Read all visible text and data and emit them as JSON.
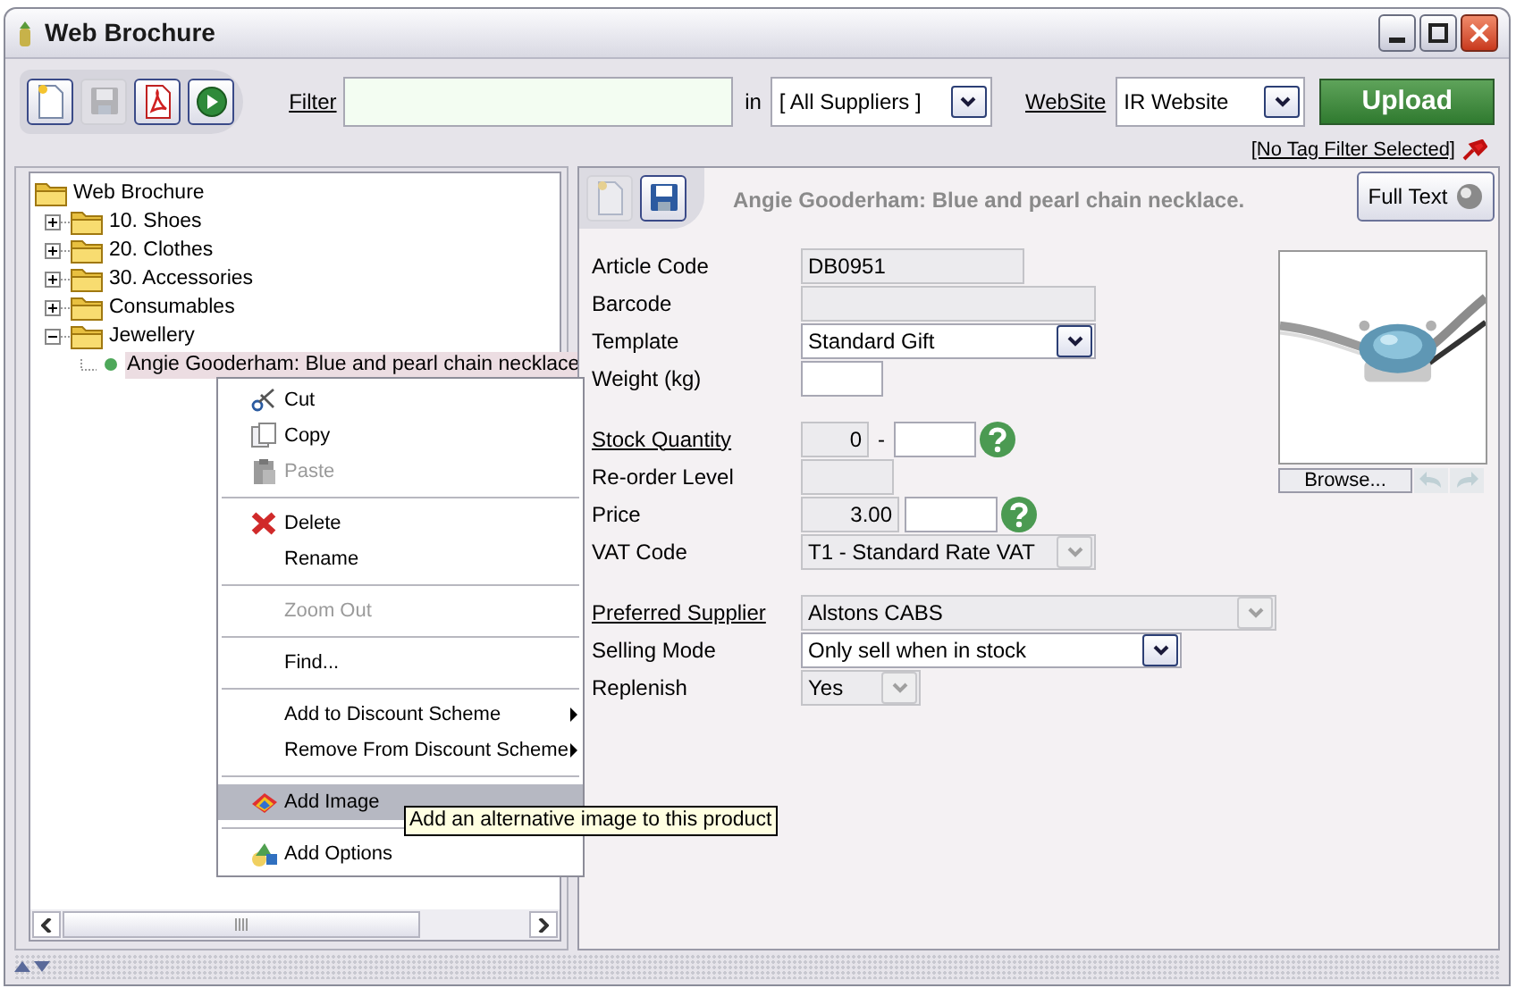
{
  "window": {
    "title": "Web Brochure"
  },
  "toolbar": {
    "buttons": [
      {
        "kind": "new",
        "disabled": false
      },
      {
        "kind": "save",
        "disabled": true
      },
      {
        "kind": "pdf",
        "disabled": false
      },
      {
        "kind": "run",
        "disabled": false
      }
    ],
    "filter": {
      "label": "Filter"
    },
    "in_label": "in",
    "supplier_select": {
      "value": "[ All Suppliers ]"
    },
    "website": {
      "label": "WebSite",
      "value": "IR Website"
    },
    "upload_button": "Upload",
    "tag_filter": "[No Tag Filter Selected]"
  },
  "tree": {
    "label": "Web Brochure",
    "kind": "folder",
    "children": [
      {
        "label": "10. Shoes",
        "kind": "folder",
        "expanded": false
      },
      {
        "label": "20. Clothes",
        "kind": "folder",
        "expanded": false
      },
      {
        "label": "30. Accessories",
        "kind": "folder",
        "expanded": false
      },
      {
        "label": "Consumables",
        "kind": "folder",
        "expanded": false
      },
      {
        "label": "Jewellery",
        "kind": "folder",
        "expanded": true,
        "children": [
          {
            "label": "Angie Gooderham: Blue and pearl chain necklace",
            "kind": "product",
            "selected": true,
            "color": "#4ea85a"
          }
        ]
      }
    ]
  },
  "context_menu": [
    {
      "kind": "item",
      "label": "Cut",
      "disabled": false,
      "selected": false
    },
    {
      "kind": "item",
      "label": "Copy",
      "disabled": false,
      "selected": false
    },
    {
      "kind": "item",
      "label": "Paste",
      "disabled": true,
      "selected": false
    },
    {
      "kind": "separator"
    },
    {
      "kind": "item",
      "label": "Delete",
      "disabled": false,
      "selected": false
    },
    {
      "kind": "item",
      "label": "Rename",
      "disabled": false,
      "selected": false
    },
    {
      "kind": "separator"
    },
    {
      "kind": "item",
      "label": "Zoom Out",
      "disabled": true,
      "selected": false
    },
    {
      "kind": "separator"
    },
    {
      "kind": "item",
      "label": "Find...",
      "disabled": false,
      "selected": false
    },
    {
      "kind": "separator"
    },
    {
      "kind": "item",
      "label": "Add to Discount Scheme",
      "disabled": false,
      "selected": false,
      "submenu": true
    },
    {
      "kind": "item",
      "label": "Remove From Discount Scheme",
      "disabled": false,
      "selected": false,
      "submenu": true
    },
    {
      "kind": "separator"
    },
    {
      "kind": "item",
      "label": "Add Image",
      "disabled": false,
      "selected": true
    },
    {
      "kind": "separator"
    },
    {
      "kind": "item",
      "label": "Add Options",
      "disabled": false,
      "selected": false
    }
  ],
  "tooltip": "Add an alternative image to this product",
  "detail": {
    "buttons": [
      {
        "kind": "new",
        "disabled": true
      },
      {
        "kind": "save",
        "disabled": false
      }
    ],
    "title": "Angie Gooderham: Blue and pearl chain necklace.",
    "full_text_button": "Full Text",
    "groups": [
      [
        {
          "label": "Article Code",
          "link": false,
          "fields": [
            {
              "kind": "input",
              "value": "DB0951",
              "disabled": true
            }
          ]
        },
        {
          "label": "Barcode",
          "link": false,
          "fields": [
            {
              "kind": "input",
              "disabled": true
            }
          ]
        },
        {
          "label": "Template",
          "link": false,
          "fields": [
            {
              "kind": "select",
              "value": "Standard Gift",
              "disabled": false
            }
          ]
        },
        {
          "label": "Weight (kg)",
          "link": false,
          "fields": [
            {
              "kind": "input",
              "disabled": false
            }
          ]
        }
      ],
      [
        {
          "label": "Stock Quantity",
          "link": true,
          "separator": "-",
          "help": true,
          "fields": [
            {
              "kind": "input",
              "value": "0",
              "disabled": true
            },
            {
              "kind": "input",
              "disabled": false
            }
          ]
        },
        {
          "label": "Re-order Level",
          "link": false,
          "fields": [
            {
              "kind": "input",
              "disabled": true
            }
          ]
        },
        {
          "label": "Price",
          "link": false,
          "help": true,
          "fields": [
            {
              "kind": "input",
              "value": "3.00",
              "disabled": true
            },
            {
              "kind": "input",
              "disabled": false
            }
          ]
        },
        {
          "label": "VAT Code",
          "link": false,
          "fields": [
            {
              "kind": "select",
              "value": "T1 - Standard Rate VAT",
              "disabled": true
            }
          ]
        }
      ],
      [
        {
          "label": "Preferred Supplier",
          "link": true,
          "fields": [
            {
              "kind": "select",
              "value": "Alstons CABS",
              "disabled": true
            }
          ]
        },
        {
          "label": "Selling Mode",
          "link": false,
          "fields": [
            {
              "kind": "select",
              "value": "Only sell when in stock",
              "disabled": false
            }
          ]
        },
        {
          "label": "Replenish",
          "link": false,
          "fields": [
            {
              "kind": "select",
              "value": "Yes",
              "disabled": true
            }
          ]
        }
      ]
    ],
    "image": {
      "browse_button": "Browse...",
      "prev_disabled": true,
      "next_disabled": true
    }
  }
}
